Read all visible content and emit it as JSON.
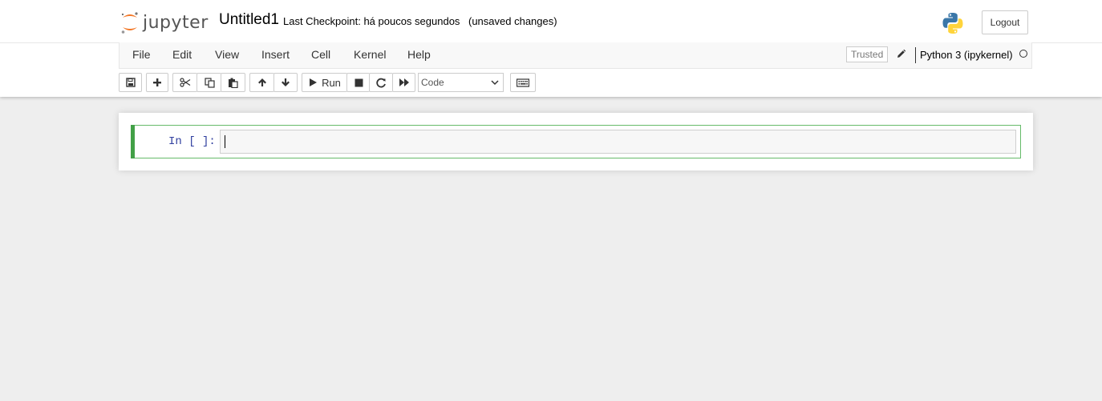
{
  "header": {
    "logo_text": "jupyter",
    "notebook_name": "Untitled1",
    "checkpoint": "Last Checkpoint: há poucos segundos",
    "autosave_status": "(unsaved changes)",
    "logout_label": "Logout"
  },
  "menubar": {
    "items": [
      "File",
      "Edit",
      "View",
      "Insert",
      "Cell",
      "Kernel",
      "Help"
    ],
    "trusted_label": "Trusted",
    "kernel_name": "Python 3 (ipykernel)"
  },
  "toolbar": {
    "buttons": [
      "save-icon",
      "plus-icon",
      "cut-icon",
      "copy-icon",
      "paste-icon",
      "arrow-up-icon",
      "arrow-down-icon",
      "run-icon",
      "stop-icon",
      "restart-icon",
      "fast-forward-icon",
      "keyboard-icon"
    ],
    "run_label": "Run",
    "cell_type": "Code"
  },
  "cell": {
    "prompt": "In [ ]:",
    "source": ""
  },
  "colors": {
    "accent_orange": "#F37726",
    "cell_border_green": "#66BB6A",
    "prompt_blue": "#303F9F"
  }
}
